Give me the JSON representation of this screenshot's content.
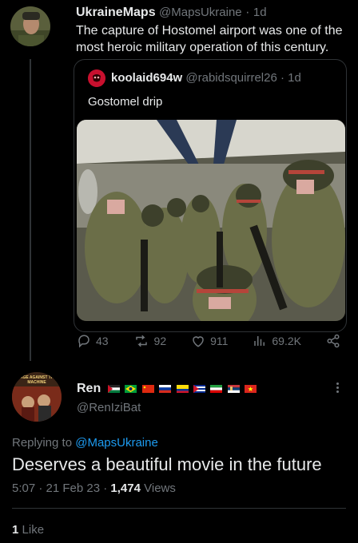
{
  "tweet": {
    "author_name": "UkraineMaps",
    "author_handle": "@MapsUkraine",
    "time": "1d",
    "text": "The capture of Hostomel airport was one of the most heroic military operation of this century.",
    "quote": {
      "author_name": "koolaid694w",
      "author_handle": "@rabidsquirrel26",
      "time": "1d",
      "text": "Gostomel drip"
    },
    "actions": {
      "replies": "43",
      "retweets": "92",
      "likes": "911",
      "views": "69.2K"
    }
  },
  "reply": {
    "author_name": "Ren",
    "author_handle": "@RenIziBat",
    "avatar_text": "RAGE AGAINST THE MACHINE",
    "replying_to_label": "Replying to",
    "replying_to_handle": "@MapsUkraine",
    "text": "Deserves a beautiful movie in the future",
    "timestamp": "5:07 · 21 Feb 23 ·",
    "views_count": "1,474",
    "views_label": "Views",
    "likes_count": "1",
    "likes_label": "Like"
  },
  "dot": "·",
  "colors": {
    "background": "#000000",
    "text": "#e7e9ea",
    "muted": "#71767b",
    "link": "#1d9bf0",
    "border": "#2f3336"
  },
  "icons": [
    "reply-icon",
    "retweet-icon",
    "like-icon",
    "views-icon",
    "share-icon",
    "more-icon"
  ]
}
